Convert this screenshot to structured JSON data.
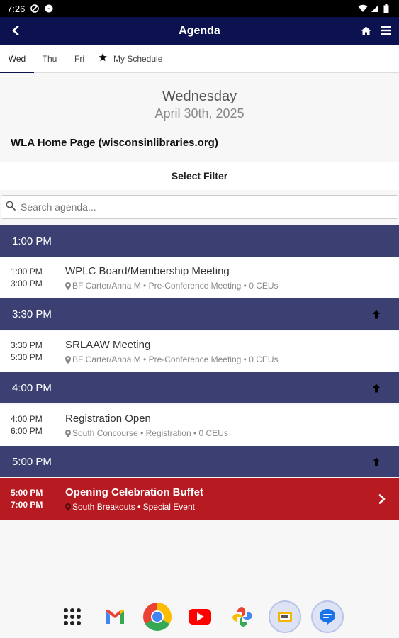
{
  "status_bar": {
    "time": "7:26"
  },
  "app_bar": {
    "title": "Agenda"
  },
  "tabs": [
    {
      "label": "Wed",
      "active": true
    },
    {
      "label": "Thu",
      "active": false
    },
    {
      "label": "Fri",
      "active": false
    },
    {
      "label": "My Schedule",
      "active": false
    }
  ],
  "date": {
    "day": "Wednesday",
    "full": "April 30th, 2025"
  },
  "home_link": "WLA Home Page (wisconsinlibraries.org)",
  "filter": {
    "label": "Select Filter"
  },
  "search": {
    "placeholder": "Search agenda..."
  },
  "time_groups": [
    {
      "label": "1:00 PM",
      "sessions": [
        {
          "start": "1:00 PM",
          "end": "3:00 PM",
          "title": "WPLC Board/Membership Meeting",
          "location": "BF Carter/Anna M",
          "type": "Pre-Conference Meeting",
          "ceus": "0 CEUs"
        }
      ]
    },
    {
      "label": "3:30 PM",
      "sessions": [
        {
          "start": "3:30 PM",
          "end": "5:30 PM",
          "title": "SRLAAW Meeting",
          "location": "BF Carter/Anna M",
          "type": "Pre-Conference Meeting",
          "ceus": "0 CEUs"
        }
      ]
    },
    {
      "label": "4:00 PM",
      "sessions": [
        {
          "start": "4:00 PM",
          "end": "6:00 PM",
          "title": "Registration Open",
          "location": "South Concourse",
          "type": "Registration",
          "ceus": "0 CEUs"
        }
      ]
    },
    {
      "label": "5:00 PM",
      "sessions": [
        {
          "start": "5:00 PM",
          "end": "7:00 PM",
          "title": "Opening Celebration Buffet",
          "location": "South Breakouts",
          "type": "Special Event"
        }
      ]
    }
  ],
  "dock": [
    "apps-grid-icon",
    "gmail-icon",
    "chrome-icon",
    "youtube-icon",
    "photos-icon",
    "slides-icon",
    "messages-icon"
  ],
  "colors": {
    "app_bar": "#0c1150",
    "time_header": "#3b3f72",
    "highlight_session": "#b81a22"
  }
}
